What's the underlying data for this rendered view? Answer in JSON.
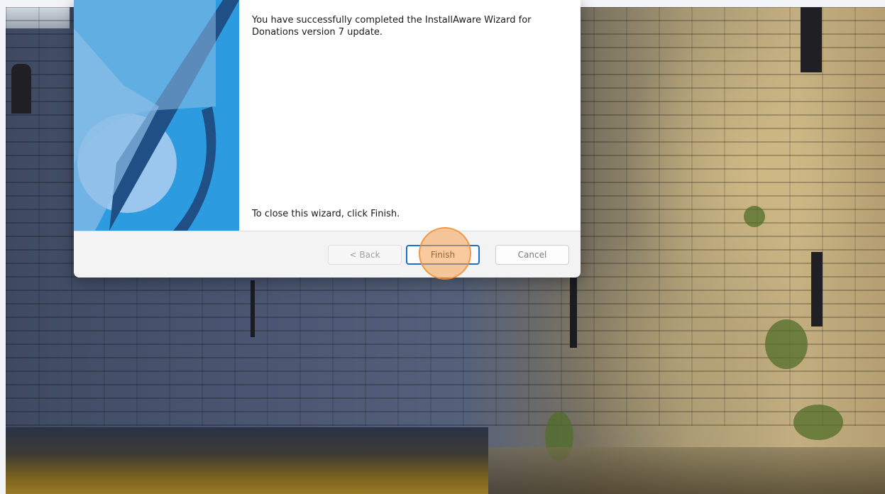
{
  "dialog": {
    "message_main": "You have successfully completed the InstallAware Wizard for Donations version 7 update.",
    "message_close": "To close this wizard, click Finish.",
    "buttons": {
      "back": "< Back",
      "finish": "Finish",
      "cancel": "Cancel"
    },
    "art_icon": "installaware-logo-art",
    "colors": {
      "art_background": "#2d9be0",
      "art_light": "#a7cbee",
      "art_dark": "#1f4f85",
      "focus_border": "#1f6fd1",
      "click_highlight": "#f5a050"
    }
  },
  "desktop": {
    "wallpaper": "castle-wall-wallpaper"
  }
}
